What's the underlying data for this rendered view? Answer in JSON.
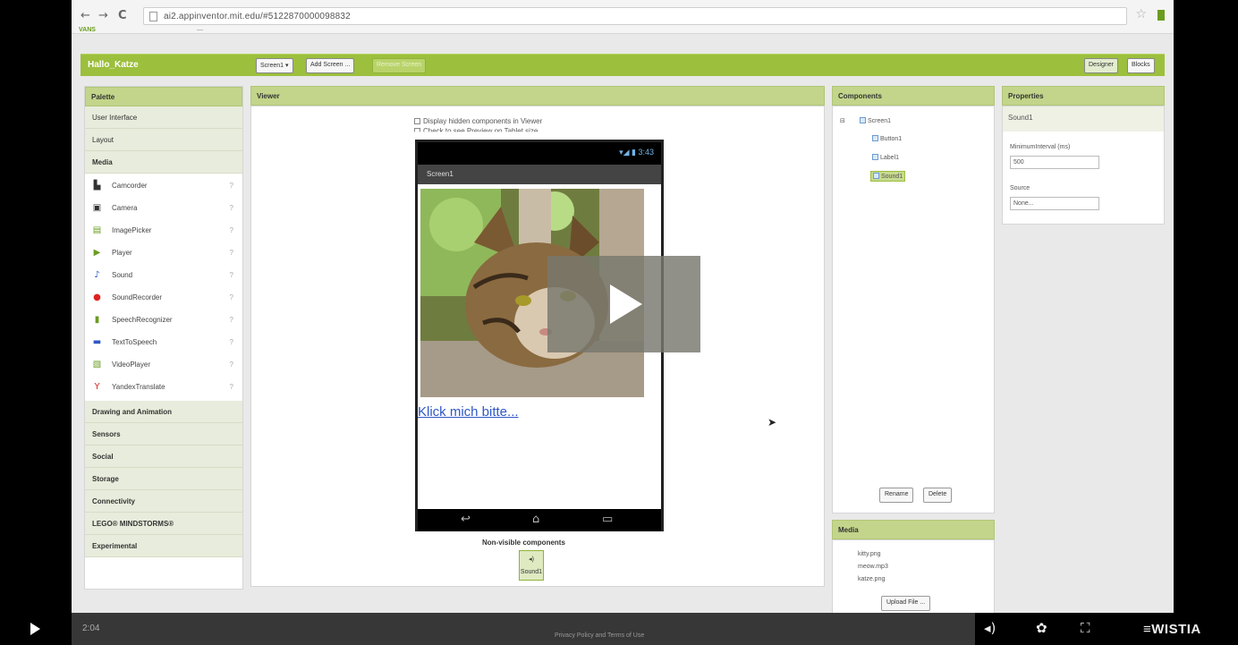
{
  "browser": {
    "back": "←",
    "forward": "→",
    "reload": "C",
    "url": "ai2.appinventor.mit.edu/#5122870000098832",
    "bookmark1": "VANS",
    "bookmark2": "—"
  },
  "app": {
    "project_name": "Hallo_Katze",
    "screen_button": "Screen1 ▾",
    "add_screen": "Add Screen ...",
    "remove_screen": "Remove Screen",
    "designer": "Designer",
    "blocks": "Blocks"
  },
  "palette": {
    "title": "Palette",
    "categories_top": [
      "User Interface",
      "Layout",
      "Media"
    ],
    "media_items": [
      {
        "label": "Camcorder",
        "icon": "camcorder-icon",
        "glyph": "▙",
        "color": "#333"
      },
      {
        "label": "Camera",
        "icon": "camera-icon",
        "glyph": "▣",
        "color": "#333"
      },
      {
        "label": "ImagePicker",
        "icon": "image-picker-icon",
        "glyph": "▤",
        "color": "#6a9c1f"
      },
      {
        "label": "Player",
        "icon": "player-icon",
        "glyph": "▶",
        "color": "#6a9c1f"
      },
      {
        "label": "Sound",
        "icon": "sound-icon",
        "glyph": "♪",
        "color": "#2f58c5"
      },
      {
        "label": "SoundRecorder",
        "icon": "sound-recorder-icon",
        "glyph": "●",
        "color": "#d22"
      },
      {
        "label": "SpeechRecognizer",
        "icon": "speech-recognizer-icon",
        "glyph": "▮",
        "color": "#6a9c1f"
      },
      {
        "label": "TextToSpeech",
        "icon": "text-to-speech-icon",
        "glyph": "▬",
        "color": "#2f58c5"
      },
      {
        "label": "VideoPlayer",
        "icon": "video-player-icon",
        "glyph": "▧",
        "color": "#6a9c1f"
      },
      {
        "label": "YandexTranslate",
        "icon": "yandex-translate-icon",
        "glyph": "Y",
        "color": "#d22"
      }
    ],
    "categories_bottom": [
      "Drawing and Animation",
      "Sensors",
      "Social",
      "Storage",
      "Connectivity",
      "LEGO® MINDSTORMS®",
      "Experimental"
    ]
  },
  "viewer": {
    "title": "Viewer",
    "check_hidden": "Display hidden components in Viewer",
    "check_tablet": "Check to see Preview on Tablet size.",
    "status_time": "▾◢ ▮ 3:43",
    "screen_title": "Screen1",
    "button_text": "Klick mich bitte...",
    "nav_back": "↩",
    "nav_home": "⌂",
    "nav_recent": "▭",
    "nonvisible_label": "Non-visible components",
    "nonvisible_item": "Sound1"
  },
  "components": {
    "title": "Components",
    "tree": [
      "Screen1",
      "Button1",
      "Label1",
      "Sound1"
    ],
    "expand": "⊟",
    "rename": "Rename",
    "delete": "Delete"
  },
  "media": {
    "title": "Media",
    "files": [
      "kitty.png",
      "meow.mp3",
      "katze.png"
    ],
    "upload": "Upload File ..."
  },
  "properties": {
    "title": "Properties",
    "component": "Sound1",
    "min_interval_label": "MinimumInterval (ms)",
    "min_interval_value": "500",
    "source_label": "Source",
    "source_value": "None..."
  },
  "player": {
    "time": "2:04",
    "privacy": "Privacy Policy and Terms of Use",
    "brand": "≡WISTIA",
    "volume": "◂)",
    "settings": "✿",
    "fullscreen": "⛶"
  }
}
